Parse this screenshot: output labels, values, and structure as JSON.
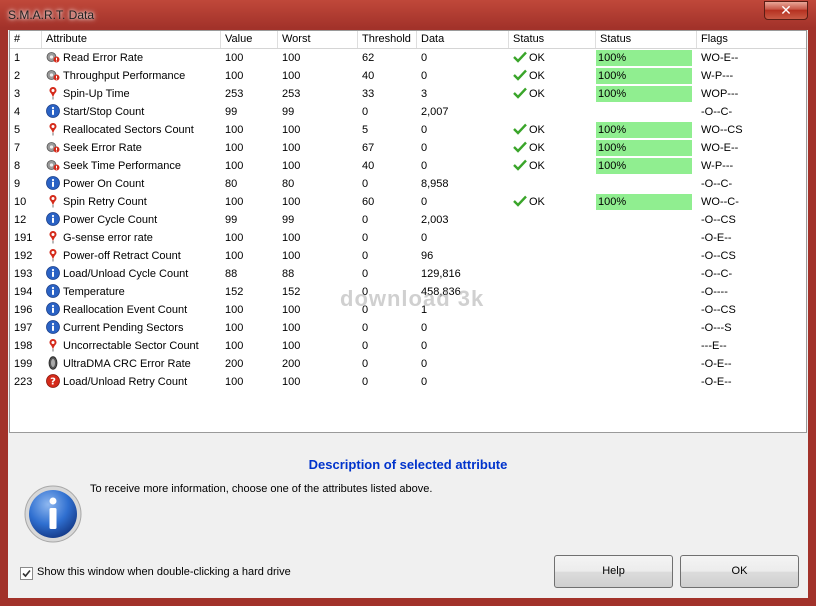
{
  "window": {
    "title": "S.M.A.R.T. Data",
    "close_label": "✕"
  },
  "columns": [
    "#",
    "Attribute",
    "Value",
    "Worst",
    "Threshold",
    "Data",
    "Status",
    "Status",
    "Flags"
  ],
  "rows": [
    {
      "id": "1",
      "icon": "critical-gear-icon",
      "attribute": "Read Error Rate",
      "value": "100",
      "worst": "100",
      "threshold": "62",
      "data": "0",
      "status": "OK",
      "health": "100%",
      "flags": "WO-E--"
    },
    {
      "id": "2",
      "icon": "critical-gear-icon",
      "attribute": "Throughput Performance",
      "value": "100",
      "worst": "100",
      "threshold": "40",
      "data": "0",
      "status": "OK",
      "health": "100%",
      "flags": "W-P---"
    },
    {
      "id": "3",
      "icon": "warning-pin-icon",
      "attribute": "Spin-Up Time",
      "value": "253",
      "worst": "253",
      "threshold": "33",
      "data": "3",
      "status": "OK",
      "health": "100%",
      "flags": "WOP---"
    },
    {
      "id": "4",
      "icon": "info-icon",
      "attribute": "Start/Stop Count",
      "value": "99",
      "worst": "99",
      "threshold": "0",
      "data": "2,007",
      "status": "",
      "health": "",
      "flags": "-O--C-"
    },
    {
      "id": "5",
      "icon": "warning-pin-icon",
      "attribute": "Reallocated Sectors Count",
      "value": "100",
      "worst": "100",
      "threshold": "5",
      "data": "0",
      "status": "OK",
      "health": "100%",
      "flags": "WO--CS"
    },
    {
      "id": "7",
      "icon": "critical-gear-icon",
      "attribute": "Seek Error Rate",
      "value": "100",
      "worst": "100",
      "threshold": "67",
      "data": "0",
      "status": "OK",
      "health": "100%",
      "flags": "WO-E--"
    },
    {
      "id": "8",
      "icon": "critical-gear-icon",
      "attribute": "Seek Time Performance",
      "value": "100",
      "worst": "100",
      "threshold": "40",
      "data": "0",
      "status": "OK",
      "health": "100%",
      "flags": "W-P---"
    },
    {
      "id": "9",
      "icon": "info-icon",
      "attribute": "Power On Count",
      "value": "80",
      "worst": "80",
      "threshold": "0",
      "data": "8,958",
      "status": "",
      "health": "",
      "flags": "-O--C-"
    },
    {
      "id": "10",
      "icon": "warning-pin-icon",
      "attribute": "Spin Retry Count",
      "value": "100",
      "worst": "100",
      "threshold": "60",
      "data": "0",
      "status": "OK",
      "health": "100%",
      "flags": "WO--C-"
    },
    {
      "id": "12",
      "icon": "info-icon",
      "attribute": "Power Cycle Count",
      "value": "99",
      "worst": "99",
      "threshold": "0",
      "data": "2,003",
      "status": "",
      "health": "",
      "flags": "-O--CS"
    },
    {
      "id": "191",
      "icon": "warning-pin-icon",
      "attribute": "G-sense error rate",
      "value": "100",
      "worst": "100",
      "threshold": "0",
      "data": "0",
      "status": "",
      "health": "",
      "flags": "-O-E--"
    },
    {
      "id": "192",
      "icon": "warning-pin-icon",
      "attribute": "Power-off Retract Count",
      "value": "100",
      "worst": "100",
      "threshold": "0",
      "data": "96",
      "status": "",
      "health": "",
      "flags": "-O--CS"
    },
    {
      "id": "193",
      "icon": "info-icon",
      "attribute": "Load/Unload Cycle Count",
      "value": "88",
      "worst": "88",
      "threshold": "0",
      "data": "129,816",
      "status": "",
      "health": "",
      "flags": "-O--C-"
    },
    {
      "id": "194",
      "icon": "info-icon",
      "attribute": "Temperature",
      "value": "152",
      "worst": "152",
      "threshold": "0",
      "data": "458,836",
      "status": "",
      "health": "",
      "flags": "-O----"
    },
    {
      "id": "196",
      "icon": "info-icon",
      "attribute": "Reallocation Event Count",
      "value": "100",
      "worst": "100",
      "threshold": "0",
      "data": "1",
      "status": "",
      "health": "",
      "flags": "-O--CS"
    },
    {
      "id": "197",
      "icon": "info-icon",
      "attribute": "Current Pending Sectors",
      "value": "100",
      "worst": "100",
      "threshold": "0",
      "data": "0",
      "status": "",
      "health": "",
      "flags": "-O---S"
    },
    {
      "id": "198",
      "icon": "warning-pin-icon",
      "attribute": "Uncorrectable Sector Count",
      "value": "100",
      "worst": "100",
      "threshold": "0",
      "data": "0",
      "status": "",
      "health": "",
      "flags": "---E--"
    },
    {
      "id": "199",
      "icon": "cable-icon",
      "attribute": "UltraDMA CRC Error Rate",
      "value": "200",
      "worst": "200",
      "threshold": "0",
      "data": "0",
      "status": "",
      "health": "",
      "flags": "-O-E--"
    },
    {
      "id": "223",
      "icon": "error-icon",
      "attribute": "Load/Unload Retry Count",
      "value": "100",
      "worst": "100",
      "threshold": "0",
      "data": "0",
      "status": "",
      "health": "",
      "flags": "-O-E--"
    }
  ],
  "watermark": "download 3k",
  "description": {
    "title": "Description of selected attribute",
    "text": "To receive more information, choose one of the attributes listed above."
  },
  "footer": {
    "checkbox_label": "Show this window when double-clicking a hard drive",
    "checkbox_checked": true,
    "help_label": "Help",
    "ok_label": "OK"
  },
  "colors": {
    "health_bar": "#90ee90",
    "ok_check": "#3aa52a",
    "description_title": "#0033cc",
    "titlebar": "#a2322a"
  }
}
